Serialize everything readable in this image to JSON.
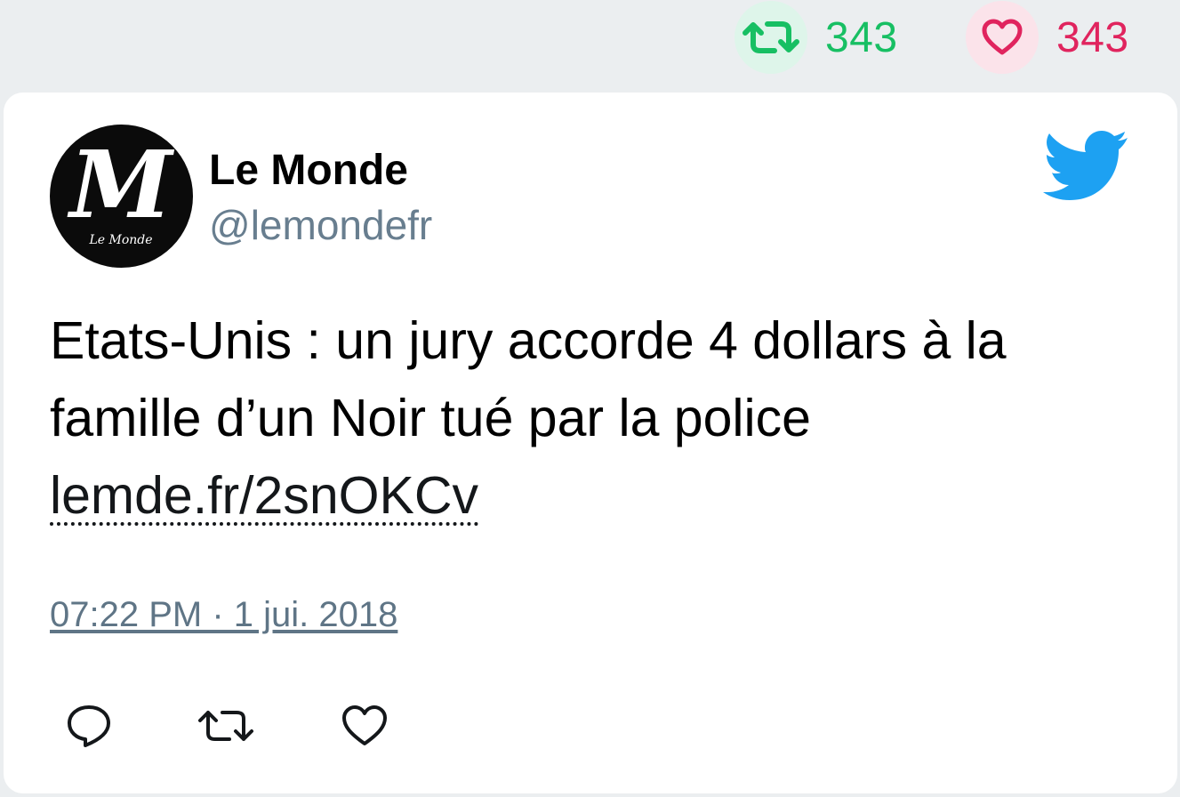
{
  "stats": {
    "retweet_icon": "retweet-icon",
    "retweet_count": "343",
    "like_icon": "heart-icon",
    "like_count": "343",
    "retweet_color": "#17bf63",
    "like_color": "#e0245e"
  },
  "tweet": {
    "author_name": "Le Monde",
    "author_handle": "@lemondefr",
    "avatar_text": "Le Monde",
    "text_line_1": "Etats-Unis : un jury accorde 4 dollars à la",
    "text_line_2": "famille d’un Noir tué par la police",
    "link_text": "lemde.fr/2snOKCv",
    "timestamp": "07:22 PM · 1 jui. 2018",
    "brand_icon": "twitter-bird-icon",
    "brand_color": "#1da1f2"
  },
  "actions": [
    {
      "icon": "reply-icon"
    },
    {
      "icon": "retweet-icon"
    },
    {
      "icon": "like-icon"
    }
  ]
}
